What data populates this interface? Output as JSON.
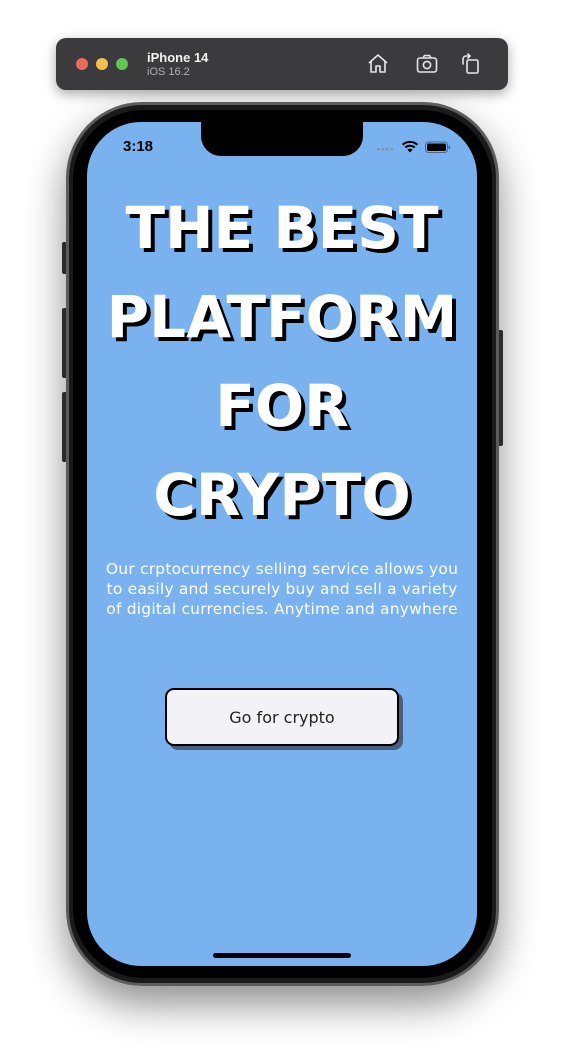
{
  "simulator": {
    "device_name": "iPhone 14",
    "os_version": "iOS 16.2",
    "toolbar_icons": [
      "home-icon",
      "screenshot-icon",
      "rotate-icon"
    ],
    "traffic_lights": {
      "close": "#ed6a5e",
      "minimize": "#f5bf4f",
      "maximize": "#61c554"
    }
  },
  "status_bar": {
    "time": "3:18",
    "icons": [
      "signal-icon",
      "wifi-icon",
      "battery-icon"
    ]
  },
  "hero": {
    "headline_lines": [
      "THE BEST",
      "PLATFORM",
      "FOR",
      "CRYPTO"
    ],
    "description": "Our crptocurrency selling service allows you to easily and securely buy and sell a variety of digital currencies. Anytime and anywhere",
    "cta_label": "Go for crypto"
  },
  "colors": {
    "screen_background": "#79b2ef",
    "headline_text": "#ffffff",
    "headline_shadow": "#000000",
    "button_background": "#f3f2f6"
  }
}
